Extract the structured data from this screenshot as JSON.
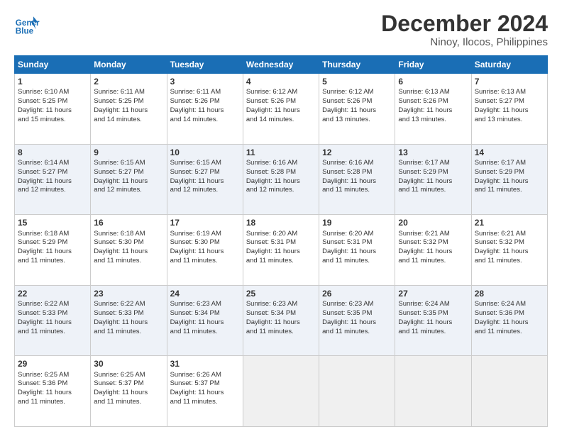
{
  "header": {
    "logo_line1": "General",
    "logo_line2": "Blue",
    "month": "December 2024",
    "location": "Ninoy, Ilocos, Philippines"
  },
  "weekdays": [
    "Sunday",
    "Monday",
    "Tuesday",
    "Wednesday",
    "Thursday",
    "Friday",
    "Saturday"
  ],
  "weeks": [
    [
      {
        "day": "1",
        "lines": [
          "Sunrise: 6:10 AM",
          "Sunset: 5:25 PM",
          "Daylight: 11 hours",
          "and 15 minutes."
        ]
      },
      {
        "day": "2",
        "lines": [
          "Sunrise: 6:11 AM",
          "Sunset: 5:25 PM",
          "Daylight: 11 hours",
          "and 14 minutes."
        ]
      },
      {
        "day": "3",
        "lines": [
          "Sunrise: 6:11 AM",
          "Sunset: 5:26 PM",
          "Daylight: 11 hours",
          "and 14 minutes."
        ]
      },
      {
        "day": "4",
        "lines": [
          "Sunrise: 6:12 AM",
          "Sunset: 5:26 PM",
          "Daylight: 11 hours",
          "and 14 minutes."
        ]
      },
      {
        "day": "5",
        "lines": [
          "Sunrise: 6:12 AM",
          "Sunset: 5:26 PM",
          "Daylight: 11 hours",
          "and 13 minutes."
        ]
      },
      {
        "day": "6",
        "lines": [
          "Sunrise: 6:13 AM",
          "Sunset: 5:26 PM",
          "Daylight: 11 hours",
          "and 13 minutes."
        ]
      },
      {
        "day": "7",
        "lines": [
          "Sunrise: 6:13 AM",
          "Sunset: 5:27 PM",
          "Daylight: 11 hours",
          "and 13 minutes."
        ]
      }
    ],
    [
      {
        "day": "8",
        "lines": [
          "Sunrise: 6:14 AM",
          "Sunset: 5:27 PM",
          "Daylight: 11 hours",
          "and 12 minutes."
        ]
      },
      {
        "day": "9",
        "lines": [
          "Sunrise: 6:15 AM",
          "Sunset: 5:27 PM",
          "Daylight: 11 hours",
          "and 12 minutes."
        ]
      },
      {
        "day": "10",
        "lines": [
          "Sunrise: 6:15 AM",
          "Sunset: 5:27 PM",
          "Daylight: 11 hours",
          "and 12 minutes."
        ]
      },
      {
        "day": "11",
        "lines": [
          "Sunrise: 6:16 AM",
          "Sunset: 5:28 PM",
          "Daylight: 11 hours",
          "and 12 minutes."
        ]
      },
      {
        "day": "12",
        "lines": [
          "Sunrise: 6:16 AM",
          "Sunset: 5:28 PM",
          "Daylight: 11 hours",
          "and 11 minutes."
        ]
      },
      {
        "day": "13",
        "lines": [
          "Sunrise: 6:17 AM",
          "Sunset: 5:29 PM",
          "Daylight: 11 hours",
          "and 11 minutes."
        ]
      },
      {
        "day": "14",
        "lines": [
          "Sunrise: 6:17 AM",
          "Sunset: 5:29 PM",
          "Daylight: 11 hours",
          "and 11 minutes."
        ]
      }
    ],
    [
      {
        "day": "15",
        "lines": [
          "Sunrise: 6:18 AM",
          "Sunset: 5:29 PM",
          "Daylight: 11 hours",
          "and 11 minutes."
        ]
      },
      {
        "day": "16",
        "lines": [
          "Sunrise: 6:18 AM",
          "Sunset: 5:30 PM",
          "Daylight: 11 hours",
          "and 11 minutes."
        ]
      },
      {
        "day": "17",
        "lines": [
          "Sunrise: 6:19 AM",
          "Sunset: 5:30 PM",
          "Daylight: 11 hours",
          "and 11 minutes."
        ]
      },
      {
        "day": "18",
        "lines": [
          "Sunrise: 6:20 AM",
          "Sunset: 5:31 PM",
          "Daylight: 11 hours",
          "and 11 minutes."
        ]
      },
      {
        "day": "19",
        "lines": [
          "Sunrise: 6:20 AM",
          "Sunset: 5:31 PM",
          "Daylight: 11 hours",
          "and 11 minutes."
        ]
      },
      {
        "day": "20",
        "lines": [
          "Sunrise: 6:21 AM",
          "Sunset: 5:32 PM",
          "Daylight: 11 hours",
          "and 11 minutes."
        ]
      },
      {
        "day": "21",
        "lines": [
          "Sunrise: 6:21 AM",
          "Sunset: 5:32 PM",
          "Daylight: 11 hours",
          "and 11 minutes."
        ]
      }
    ],
    [
      {
        "day": "22",
        "lines": [
          "Sunrise: 6:22 AM",
          "Sunset: 5:33 PM",
          "Daylight: 11 hours",
          "and 11 minutes."
        ]
      },
      {
        "day": "23",
        "lines": [
          "Sunrise: 6:22 AM",
          "Sunset: 5:33 PM",
          "Daylight: 11 hours",
          "and 11 minutes."
        ]
      },
      {
        "day": "24",
        "lines": [
          "Sunrise: 6:23 AM",
          "Sunset: 5:34 PM",
          "Daylight: 11 hours",
          "and 11 minutes."
        ]
      },
      {
        "day": "25",
        "lines": [
          "Sunrise: 6:23 AM",
          "Sunset: 5:34 PM",
          "Daylight: 11 hours",
          "and 11 minutes."
        ]
      },
      {
        "day": "26",
        "lines": [
          "Sunrise: 6:23 AM",
          "Sunset: 5:35 PM",
          "Daylight: 11 hours",
          "and 11 minutes."
        ]
      },
      {
        "day": "27",
        "lines": [
          "Sunrise: 6:24 AM",
          "Sunset: 5:35 PM",
          "Daylight: 11 hours",
          "and 11 minutes."
        ]
      },
      {
        "day": "28",
        "lines": [
          "Sunrise: 6:24 AM",
          "Sunset: 5:36 PM",
          "Daylight: 11 hours",
          "and 11 minutes."
        ]
      }
    ],
    [
      {
        "day": "29",
        "lines": [
          "Sunrise: 6:25 AM",
          "Sunset: 5:36 PM",
          "Daylight: 11 hours",
          "and 11 minutes."
        ]
      },
      {
        "day": "30",
        "lines": [
          "Sunrise: 6:25 AM",
          "Sunset: 5:37 PM",
          "Daylight: 11 hours",
          "and 11 minutes."
        ]
      },
      {
        "day": "31",
        "lines": [
          "Sunrise: 6:26 AM",
          "Sunset: 5:37 PM",
          "Daylight: 11 hours",
          "and 11 minutes."
        ]
      },
      null,
      null,
      null,
      null
    ]
  ]
}
